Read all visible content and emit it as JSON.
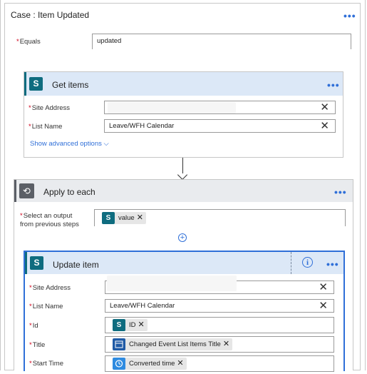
{
  "case_card": {
    "title": "Case : Item Updated",
    "equals_label": "Equals",
    "equals_value": "updated"
  },
  "get_items": {
    "title": "Get items",
    "site_address_label": "Site Address",
    "site_address_value": "",
    "list_name_label": "List Name",
    "list_name_value": "Leave/WFH Calendar",
    "show_advanced": "Show advanced options"
  },
  "apply_each": {
    "title": "Apply to each",
    "select_output_label_1": "Select an output",
    "select_output_label_2": "from previous steps",
    "token_value": "value"
  },
  "update_item": {
    "title": "Update item",
    "site_address_label": "Site Address",
    "list_name_label": "List Name",
    "list_name_value": "Leave/WFH Calendar",
    "id_label": "Id",
    "id_token": "ID",
    "title_label": "Title",
    "title_token": "Changed Event List Items Title",
    "start_time_label": "Start Time",
    "start_time_token": "Converted time"
  },
  "icons": {
    "more": "more-dots-icon",
    "sharepoint": "sharepoint-icon",
    "loop": "loop-icon",
    "info": "info-icon",
    "add": "add-icon",
    "arrow": "arrow-down-icon",
    "calendar": "calendar-icon",
    "clock": "clock-icon"
  },
  "colors": {
    "accent": "#2f6fd8",
    "sharepoint": "#0f6c7f",
    "header_bg": "#dce8f7",
    "required": "#d0021b"
  }
}
